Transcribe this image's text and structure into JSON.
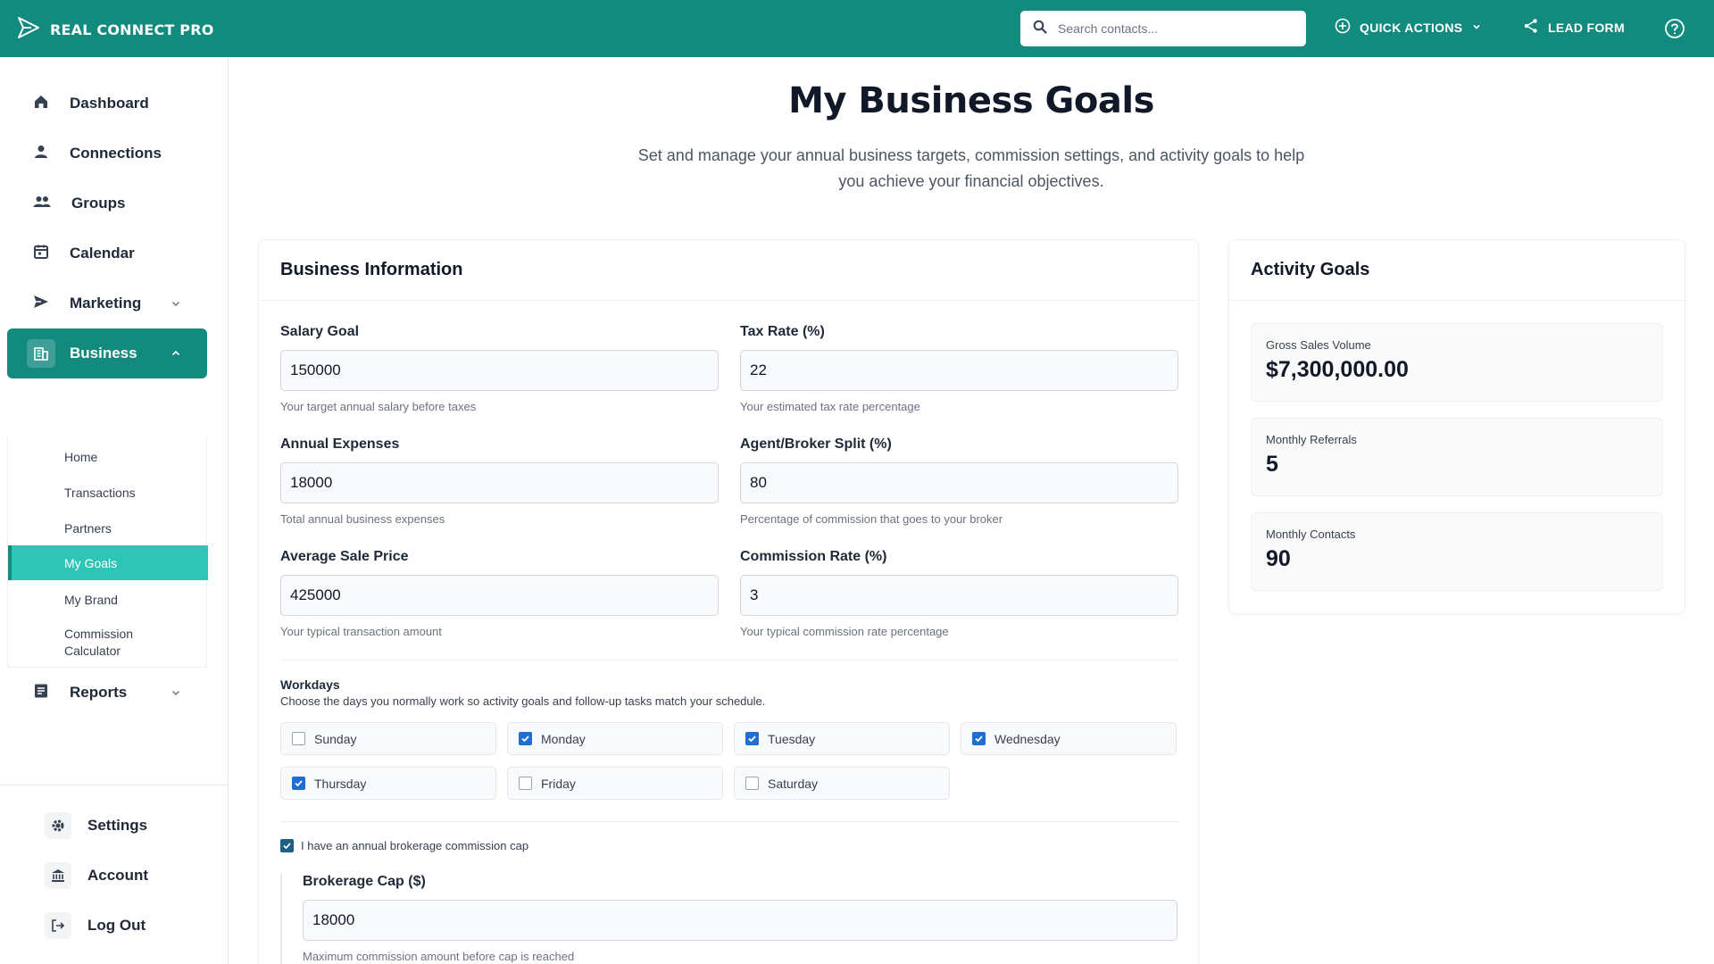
{
  "app": {
    "name": "REAL CONNECT PRO"
  },
  "header": {
    "search_placeholder": "Search contacts...",
    "quick_actions": "QUICK ACTIONS",
    "lead_form": "LEAD FORM"
  },
  "sidebar": {
    "items": [
      {
        "label": "Dashboard"
      },
      {
        "label": "Connections"
      },
      {
        "label": "Groups"
      },
      {
        "label": "Calendar"
      },
      {
        "label": "Marketing"
      },
      {
        "label": "Business"
      },
      {
        "label": "Reports"
      }
    ],
    "business_sub": [
      {
        "label": "Home"
      },
      {
        "label": "Transactions"
      },
      {
        "label": "Partners"
      },
      {
        "label": "My Goals"
      },
      {
        "label": "My Brand"
      },
      {
        "label": "Commission Calculator"
      }
    ],
    "bottom": [
      {
        "label": "Settings"
      },
      {
        "label": "Account"
      },
      {
        "label": "Log Out"
      }
    ]
  },
  "page": {
    "title": "My Business Goals",
    "subtitle": "Set and manage your annual business targets, commission settings, and activity goals to help you achieve your financial objectives."
  },
  "business": {
    "title": "Business Information",
    "salary_goal": {
      "label": "Salary Goal",
      "value": "150000",
      "hint": "Your target annual salary before taxes"
    },
    "tax_rate": {
      "label": "Tax Rate (%)",
      "value": "22",
      "hint": "Your estimated tax rate percentage"
    },
    "annual_expenses": {
      "label": "Annual Expenses",
      "value": "18000",
      "hint": "Total annual business expenses"
    },
    "split": {
      "label": "Agent/Broker Split (%)",
      "value": "80",
      "hint": "Percentage of commission that goes to your broker"
    },
    "avg_price": {
      "label": "Average Sale Price",
      "value": "425000",
      "hint": "Your typical transaction amount"
    },
    "commission_rate": {
      "label": "Commission Rate (%)",
      "value": "3",
      "hint": "Your typical commission rate percentage"
    },
    "workdays": {
      "title": "Workdays",
      "description": "Choose the days you normally work so activity goals and follow-up tasks match your schedule.",
      "days": [
        {
          "label": "Sunday",
          "checked": false
        },
        {
          "label": "Monday",
          "checked": true
        },
        {
          "label": "Tuesday",
          "checked": true
        },
        {
          "label": "Wednesday",
          "checked": true
        },
        {
          "label": "Thursday",
          "checked": true
        },
        {
          "label": "Friday",
          "checked": false
        },
        {
          "label": "Saturday",
          "checked": false
        }
      ]
    },
    "cap_check": {
      "label": "I have an annual brokerage commission cap",
      "checked": true
    },
    "cap": {
      "label": "Brokerage Cap ($)",
      "value": "18000",
      "hint": "Maximum commission amount before cap is reached"
    }
  },
  "activity": {
    "title": "Activity Goals",
    "items": [
      {
        "label": "Gross Sales Volume",
        "value": "$7,300,000.00"
      },
      {
        "label": "Monthly Referrals",
        "value": "5"
      },
      {
        "label": "Monthly Contacts",
        "value": "90"
      }
    ]
  },
  "colors": {
    "primary": "#138a7e",
    "accent": "#2ec4b6",
    "checkbox": "#1f6fd1"
  }
}
